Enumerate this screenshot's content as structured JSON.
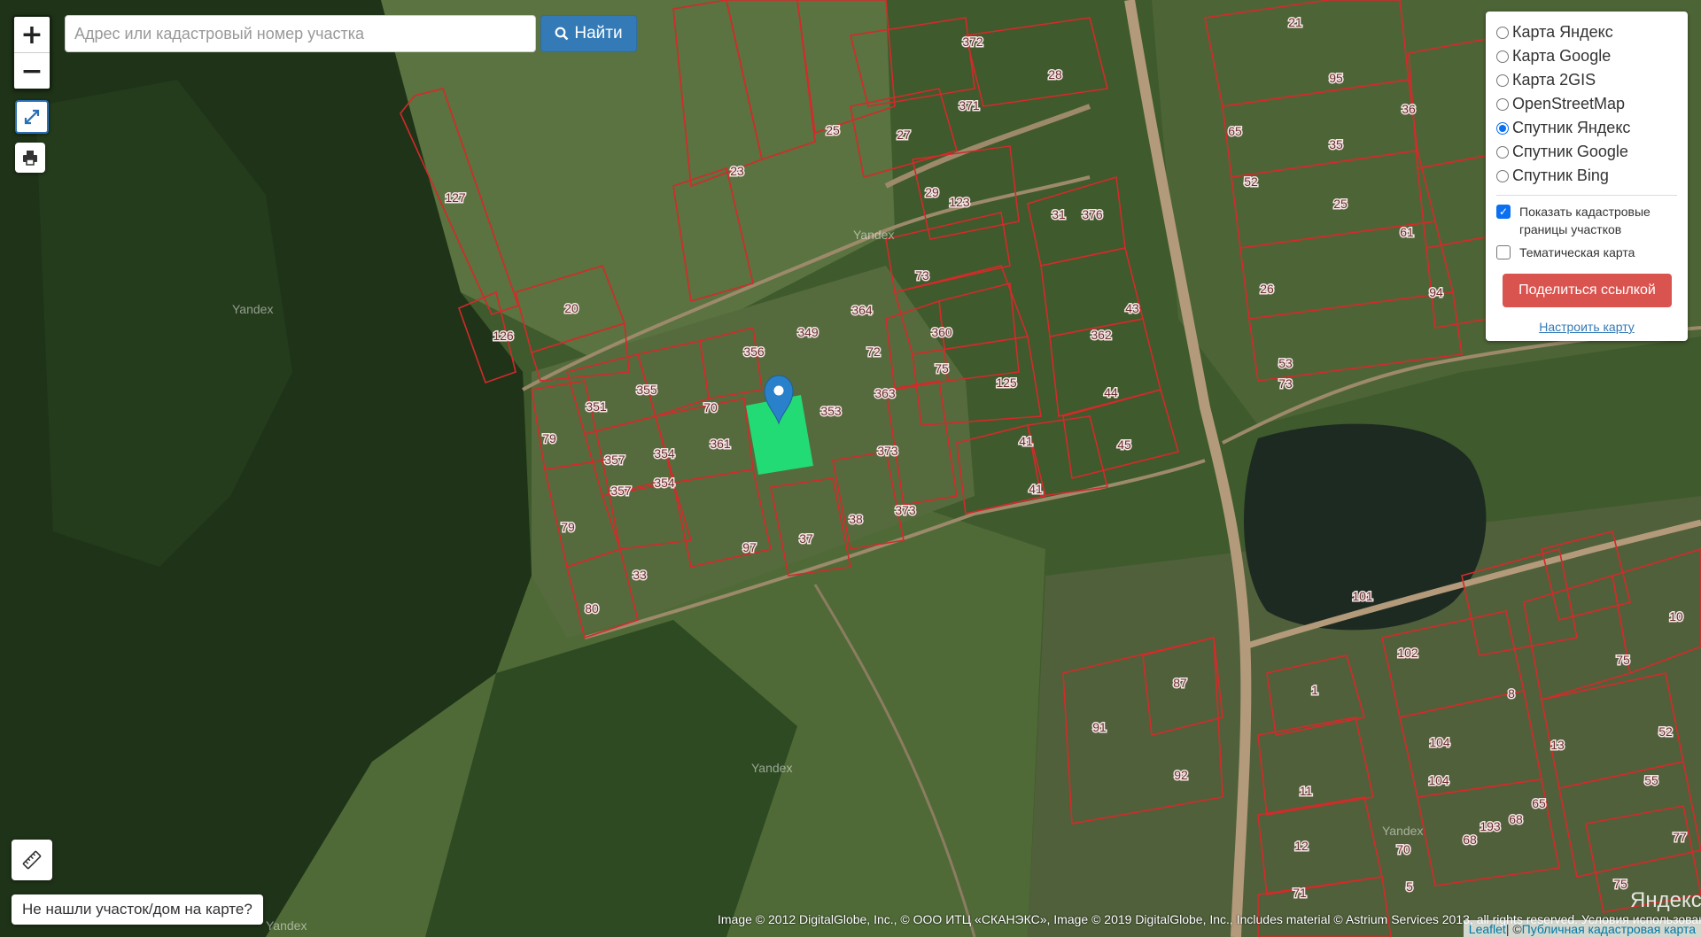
{
  "search": {
    "placeholder": "Адрес или кадастровый номер участка",
    "button_label": "Найти"
  },
  "zoom": {
    "in_label": "+",
    "out_label": "−"
  },
  "layers": {
    "options": [
      {
        "label": "Карта Яндекс",
        "selected": false
      },
      {
        "label": "Карта Google",
        "selected": false
      },
      {
        "label": "Карта 2GIS",
        "selected": false
      },
      {
        "label": "OpenStreetMap",
        "selected": false
      },
      {
        "label": "Спутник Яндекс",
        "selected": true
      },
      {
        "label": "Спутник Google",
        "selected": false
      },
      {
        "label": "Спутник Bing",
        "selected": false
      }
    ],
    "show_boundaries_label": "Показать кадастровые границы участков",
    "show_boundaries_checked": true,
    "thematic_label": "Тематическая карта",
    "thematic_checked": false,
    "share_label": "Поделиться ссылкой",
    "setup_label": "Настроить карту"
  },
  "not_found_label": "Не нашли участок/дом на карте?",
  "attribution": {
    "imagery": "Image © 2012 DigitalGlobe, Inc., © ООО ИТЦ «СКАНЭКС», Image © 2019 DigitalGlobe, Inc., Includes material © Astrium Services 2013, all rights reserved. Условия использования",
    "leaflet": "Leaflet",
    "separator": " | © ",
    "source": "Публичная кадастровая карта",
    "yandex_logo": "Яндекс"
  },
  "watermark": "Yandex",
  "colors": {
    "boundary": "#d42a2a",
    "selected_parcel": "#1ee87a",
    "marker": "#2a81cb",
    "primary": "#337ab7",
    "danger": "#d9534f"
  },
  "parcel_labels": [
    "372",
    "21",
    "28",
    "95",
    "36",
    "371",
    "25",
    "27",
    "65",
    "35",
    "23",
    "29",
    "123",
    "52",
    "31",
    "376",
    "25",
    "61",
    "127",
    "73",
    "26",
    "94",
    "20",
    "364",
    "349",
    "43",
    "126",
    "356",
    "72",
    "360",
    "75",
    "362",
    "363",
    "53",
    "73",
    "355",
    "70",
    "351",
    "125",
    "44",
    "353",
    "79",
    "354",
    "361",
    "373",
    "41",
    "45",
    "357",
    "354",
    "357",
    "79",
    "41",
    "37",
    "38",
    "373",
    "97",
    "33",
    "80",
    "101",
    "102",
    "75",
    "87",
    "1",
    "8",
    "91",
    "52",
    "104",
    "13",
    "92",
    "104",
    "55",
    "11",
    "65",
    "68",
    "193",
    "12",
    "70",
    "68",
    "5",
    "71",
    "77",
    "75",
    "10"
  ]
}
